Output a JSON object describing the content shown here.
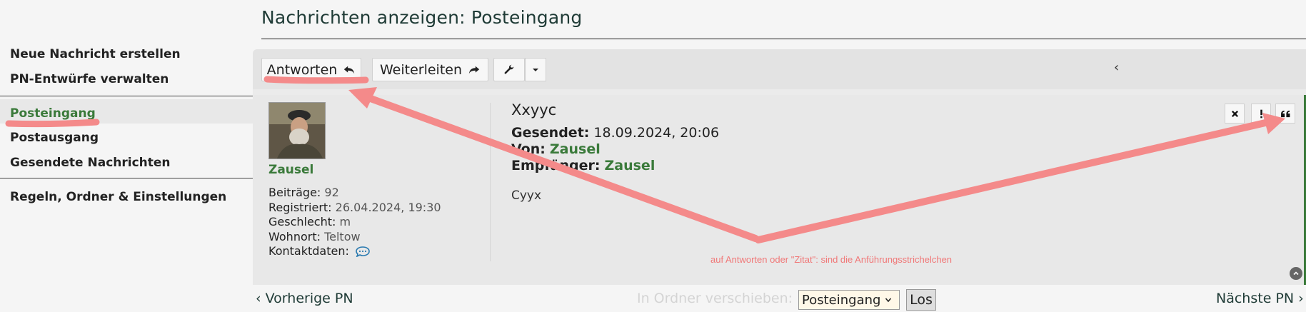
{
  "page": {
    "title": "Nachrichten anzeigen: Posteingang"
  },
  "sidebar": {
    "items": [
      {
        "label": "Neue Nachricht erstellen"
      },
      {
        "label": "PN-Entwürfe verwalten"
      },
      {
        "label": "Posteingang",
        "active": true
      },
      {
        "label": "Postausgang"
      },
      {
        "label": "Gesendete Nachrichten"
      },
      {
        "label": "Regeln, Ordner & Einstellungen"
      }
    ]
  },
  "toolbar": {
    "reply_label": "Antworten",
    "forward_label": "Weiterleiten",
    "collapse_glyph": "‹"
  },
  "author": {
    "username": "Zausel",
    "profile": [
      {
        "key": "Beiträge:",
        "value": "92"
      },
      {
        "key": "Registriert:",
        "value": "26.04.2024, 19:30"
      },
      {
        "key": "Geschlecht:",
        "value": "m"
      },
      {
        "key": "Wohnort:",
        "value": "Teltow"
      },
      {
        "key": "Kontaktdaten:",
        "value": ""
      }
    ]
  },
  "message": {
    "subject": "Xxyyc",
    "sent_label": "Gesendet:",
    "sent_value": "18.09.2024, 20:06",
    "from_label": "Von:",
    "from_value": "Zausel",
    "to_label": "Empfänger:",
    "to_value": "Zausel",
    "body": "Cyyx"
  },
  "annotation": {
    "text": "auf Antworten oder \"Zitat\": sind die Anführungsstrichelchen"
  },
  "footer": {
    "prev_label": "Vorherige PN",
    "next_label": "Nächste PN",
    "move_label": "In Ordner verschieben:",
    "folder_selected": "Posteingang",
    "go_label": "Los"
  },
  "colors": {
    "accent_green": "#3a7a3a",
    "annotation_red": "#f07878"
  },
  "icons": {
    "reply": "reply-arrow-icon",
    "forward": "forward-arrow-icon",
    "tools": "wrench-icon",
    "delete": "close-icon",
    "report": "exclamation-icon",
    "quote": "quote-icon",
    "contact": "speech-bubble-icon"
  }
}
